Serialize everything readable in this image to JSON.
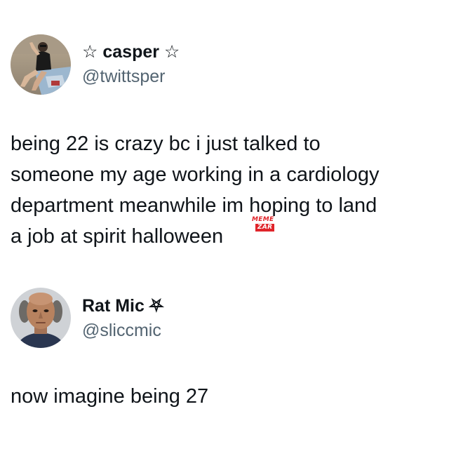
{
  "tweets": [
    {
      "author_name": "☆ casper ☆",
      "author_handle": "@twittsper",
      "text": "being 22 is crazy bc i just talked to\nsomeone my age working in a cardiology\ndepartment meanwhile im hoping to land\na job at spirit halloween",
      "avatar_icon": "profile-photo-beach"
    },
    {
      "author_name": "Rat Mic ⛧",
      "author_handle": "@sliccmic",
      "text": "now imagine being 27",
      "avatar_icon": "profile-photo-portrait"
    }
  ],
  "watermark": {
    "line1": "MEME",
    "line2": "ZAR"
  },
  "colors": {
    "text": "#0f1419",
    "handle": "#536471",
    "watermark_red": "#e0242a",
    "background": "#ffffff"
  }
}
